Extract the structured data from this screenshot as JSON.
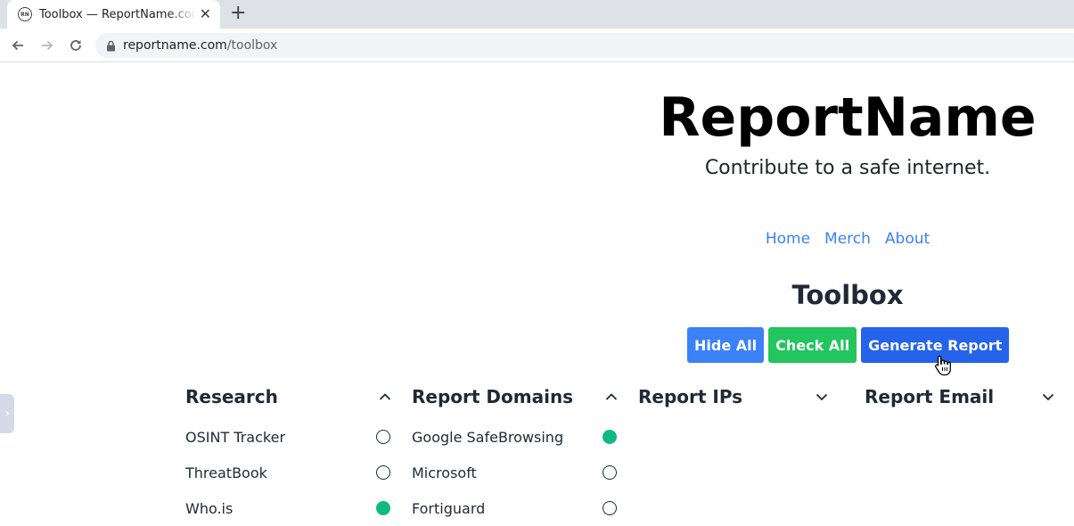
{
  "browser": {
    "tab_title": "Toolbox — ReportName.com",
    "favicon_text": "RN",
    "url_host": "reportname.com",
    "url_path": "/toolbox"
  },
  "site": {
    "brand": "ReportName",
    "tagline": "Contribute to a safe internet.",
    "nav": [
      "Home",
      "Merch",
      "About"
    ],
    "page_title": "Toolbox"
  },
  "actions": {
    "hide_all": "Hide All",
    "check_all": "Check All",
    "generate_report": "Generate Report"
  },
  "columns": [
    {
      "title": "Research",
      "expanded": true,
      "items": [
        {
          "label": "OSINT Tracker",
          "checked": false
        },
        {
          "label": "ThreatBook",
          "checked": false
        },
        {
          "label": "Who.is",
          "checked": true
        }
      ]
    },
    {
      "title": "Report Domains",
      "expanded": true,
      "items": [
        {
          "label": "Google SafeBrowsing",
          "checked": true
        },
        {
          "label": "Microsoft",
          "checked": false
        },
        {
          "label": "Fortiguard",
          "checked": false
        }
      ]
    },
    {
      "title": "Report IPs",
      "expanded": false,
      "items": []
    },
    {
      "title": "Report Email",
      "expanded": false,
      "items": []
    }
  ],
  "colors": {
    "accent_blue": "#3b82f6",
    "check_green": "#22c55e",
    "selected_radio": "#10b981",
    "generate_blue": "#2563eb"
  }
}
